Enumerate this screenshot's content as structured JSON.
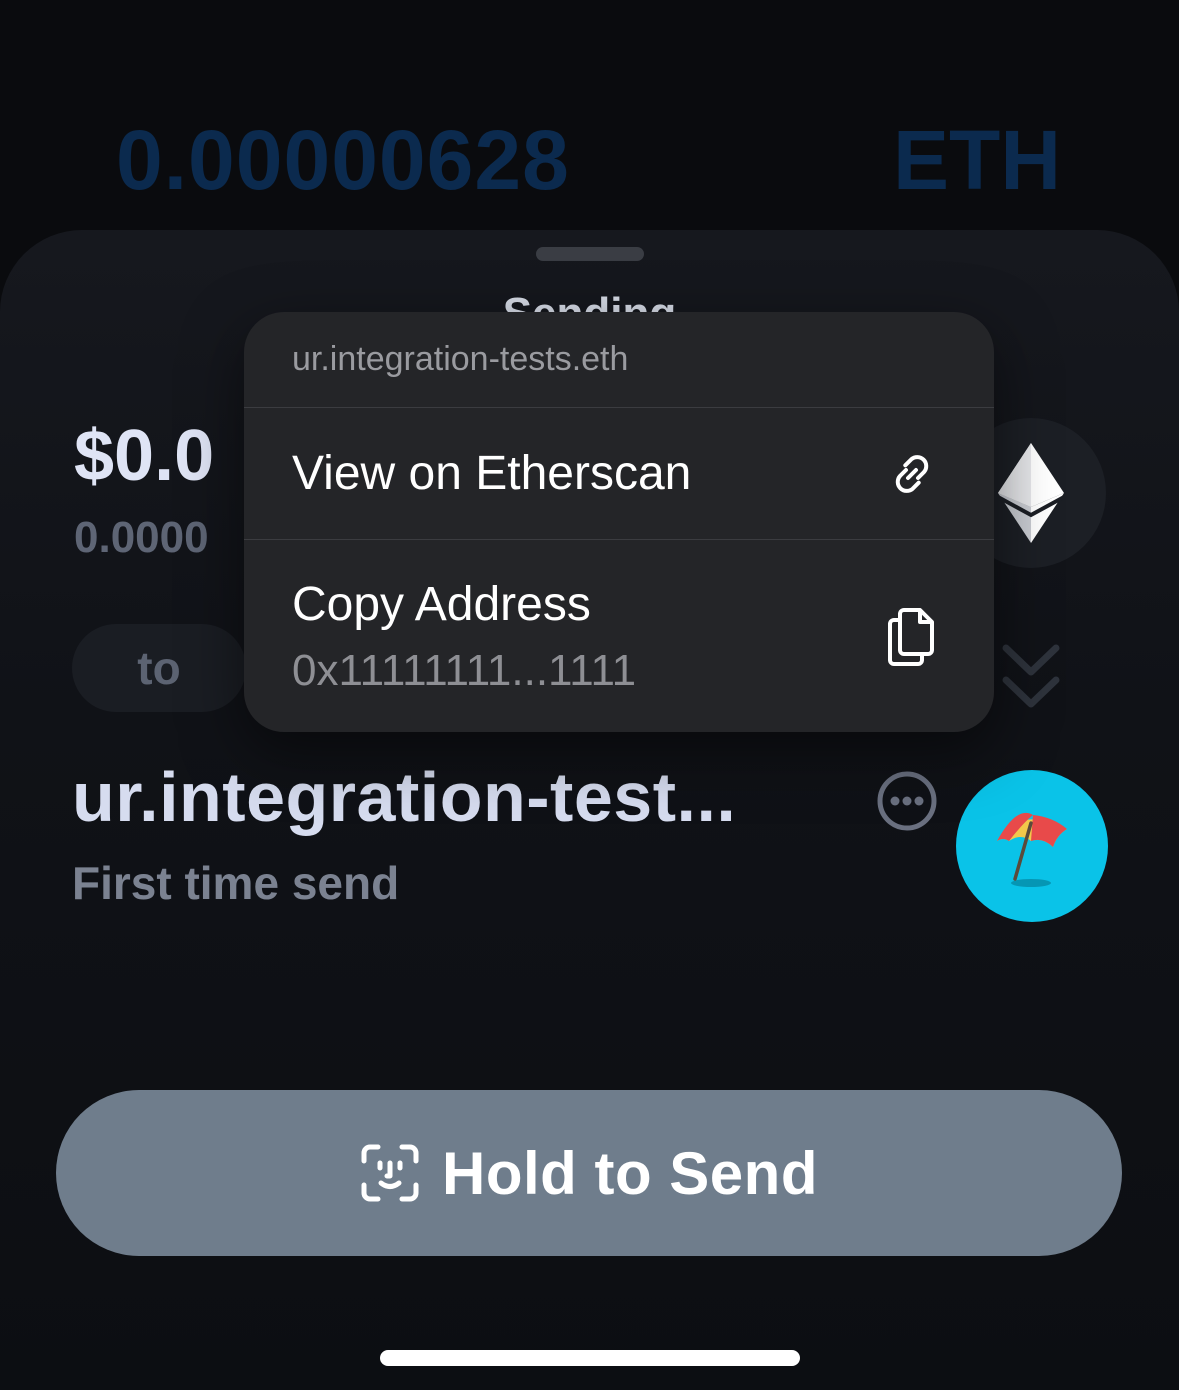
{
  "background": {
    "amount": "0.00000628",
    "symbol": "ETH"
  },
  "sheet": {
    "title": "Sending",
    "fiat_amount": "$0.0",
    "native_amount": "0.0000",
    "to_label": "to",
    "recipient_name": "ur.integration-test...",
    "recipient_subtitle": "First time send",
    "hold_label": "Hold to Send"
  },
  "context_menu": {
    "header": "ur.integration-tests.eth",
    "items": [
      {
        "label": "View on Etherscan",
        "icon": "link-icon"
      },
      {
        "label": "Copy Address",
        "sublabel": "0x11111111...1111",
        "icon": "copy-icon"
      }
    ]
  },
  "colors": {
    "accent_button": "#6f7d8c",
    "avatar_bg": "#0ac3e8",
    "background_amount": "#0b2a4e"
  }
}
